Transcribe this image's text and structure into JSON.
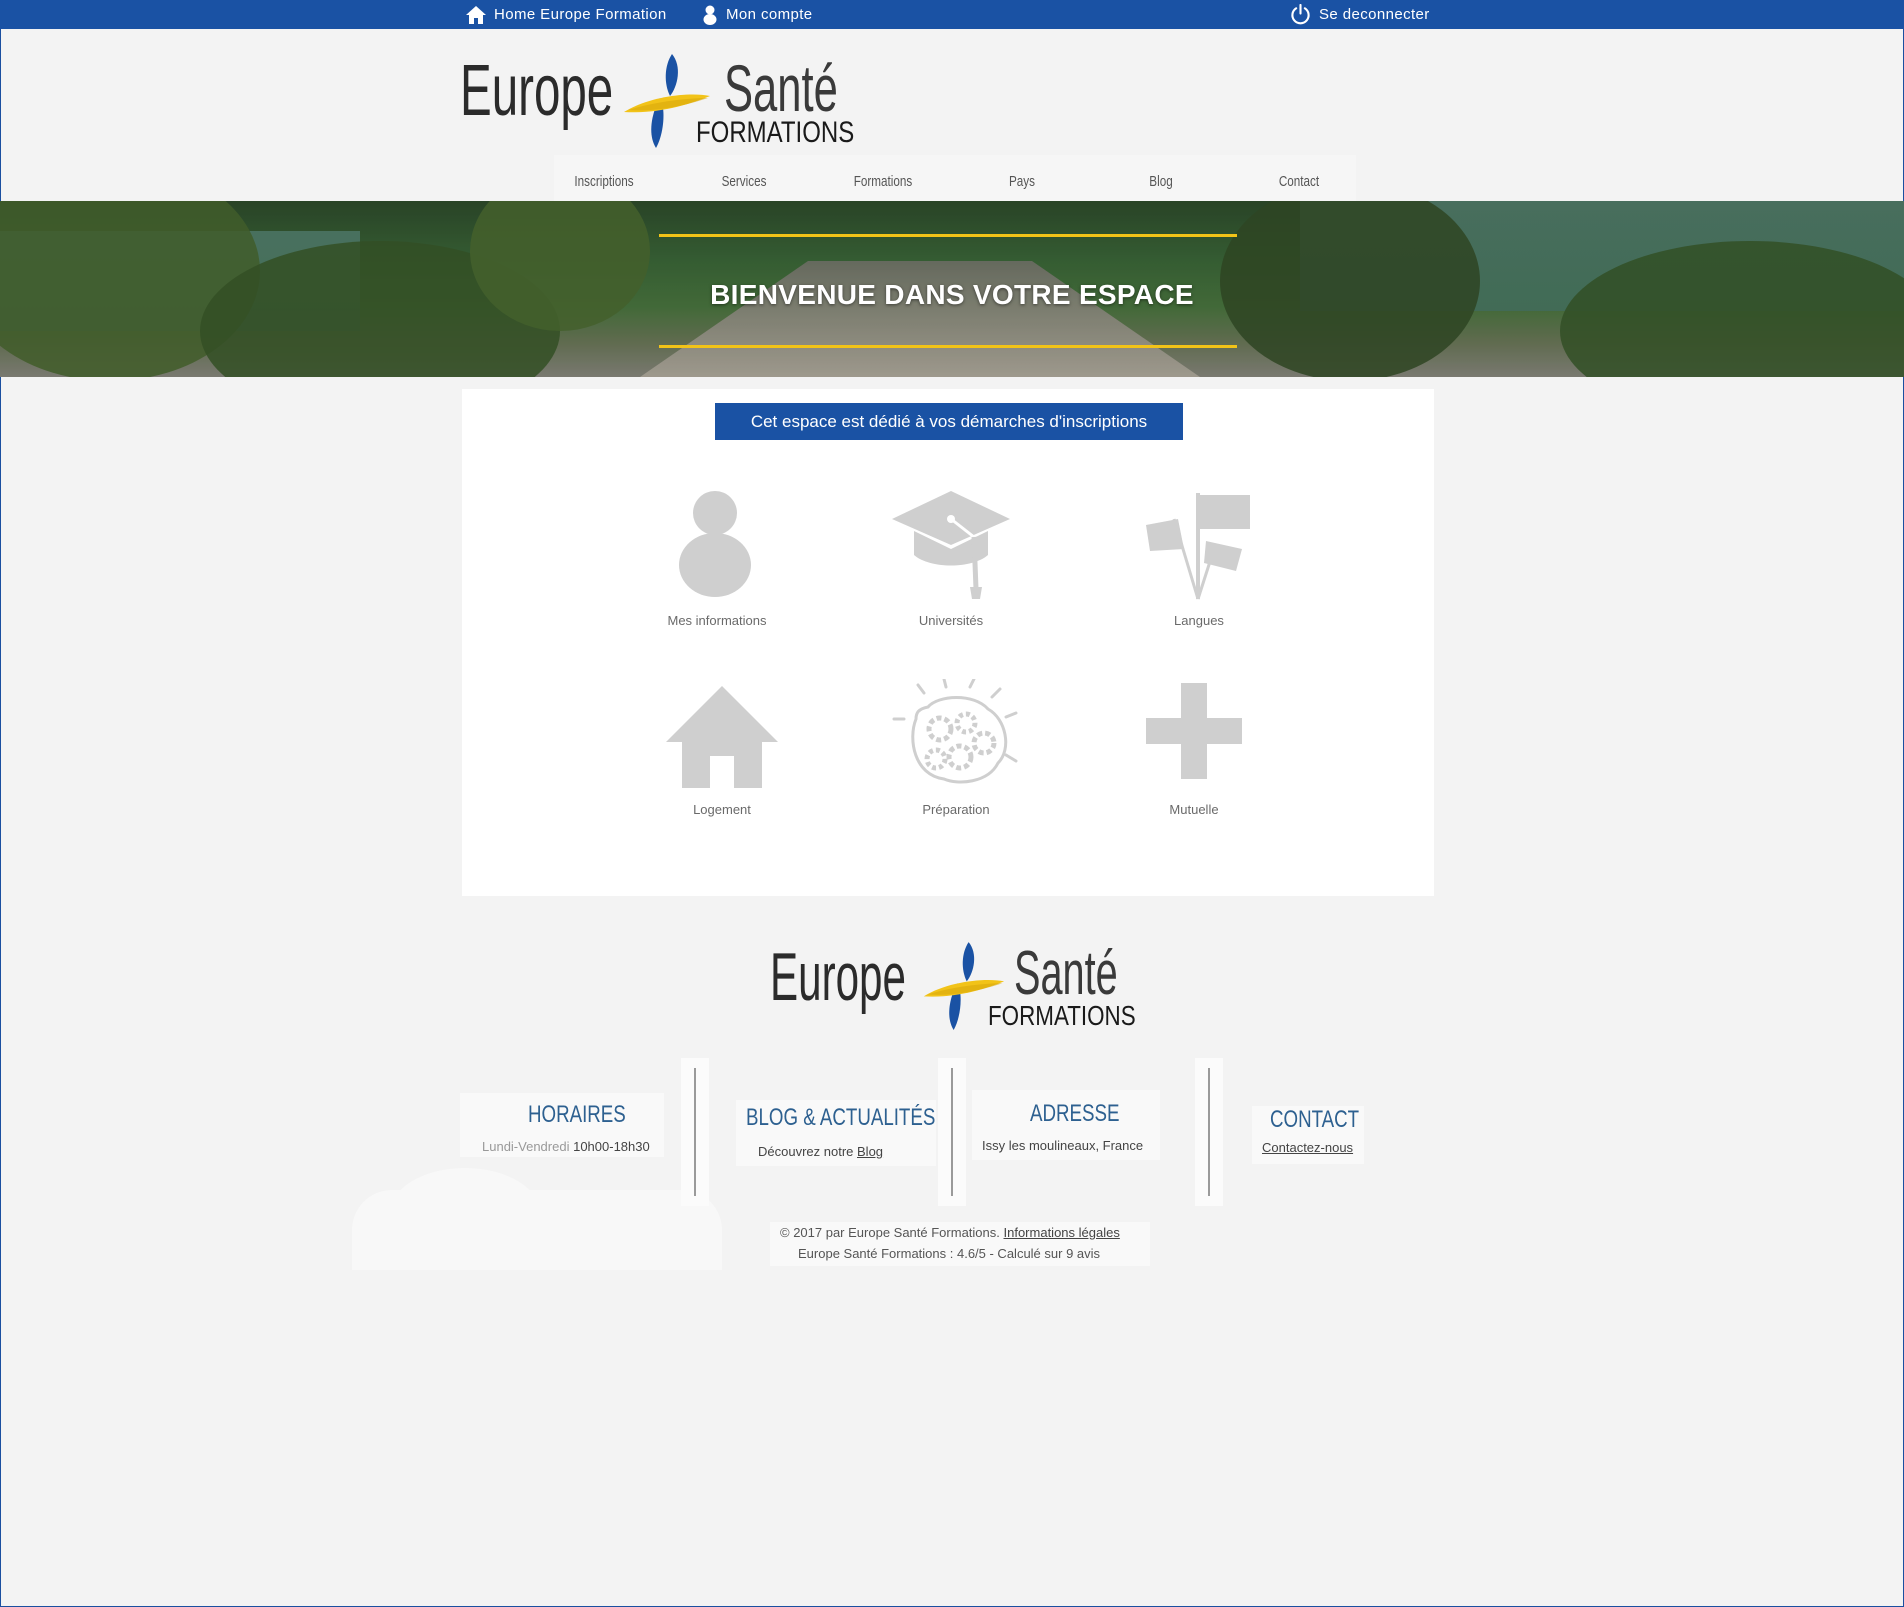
{
  "topbar": {
    "home_label": "Home Europe Formation",
    "account_label": "Mon compte",
    "logout_label": "Se deconnecter"
  },
  "logo": {
    "word1": "Europe",
    "word2": "Santé",
    "word3": "FORMATIONS"
  },
  "nav": {
    "items": [
      "Inscriptions",
      "Services",
      "Formations",
      "Pays",
      "Blog",
      "Contact"
    ]
  },
  "banner": {
    "title": "BIENVENUE DANS VOTRE ESPACE"
  },
  "main": {
    "intro": "Cet espace est dédié à vos démarches d'inscriptions",
    "tiles": [
      {
        "label": "Mes informations",
        "icon": "person-icon"
      },
      {
        "label": "Universités",
        "icon": "graduation-cap-icon"
      },
      {
        "label": "Langues",
        "icon": "flags-icon"
      },
      {
        "label": "Logement",
        "icon": "house-icon"
      },
      {
        "label": "Préparation",
        "icon": "brain-gears-icon"
      },
      {
        "label": "Mutuelle",
        "icon": "cross-icon"
      }
    ]
  },
  "footer": {
    "horaires_title": "HORAIRES",
    "horaires_days": "Lundi-Vendredi",
    "horaires_hours": "10h00-18h30",
    "blog_title": "BLOG & ACTUALITÉS",
    "blog_text": "Découvrez notre",
    "blog_link": "Blog",
    "adresse_title": "ADRESSE",
    "adresse_text": "Issy les moulineaux, France",
    "contact_title": "CONTACT",
    "contact_link": "Contactez-nous",
    "copyright": "© 2017 par Europe Santé Formations.",
    "legal_link": "Informations légales",
    "rating": "Europe Santé Formations : 4.6/5 - Calculé sur 9 avis"
  },
  "colors": {
    "brand_blue": "#1a52a4",
    "accent_yellow": "#f2c318",
    "icon_grey": "#cfcfcf",
    "footer_title": "#2d6090"
  }
}
